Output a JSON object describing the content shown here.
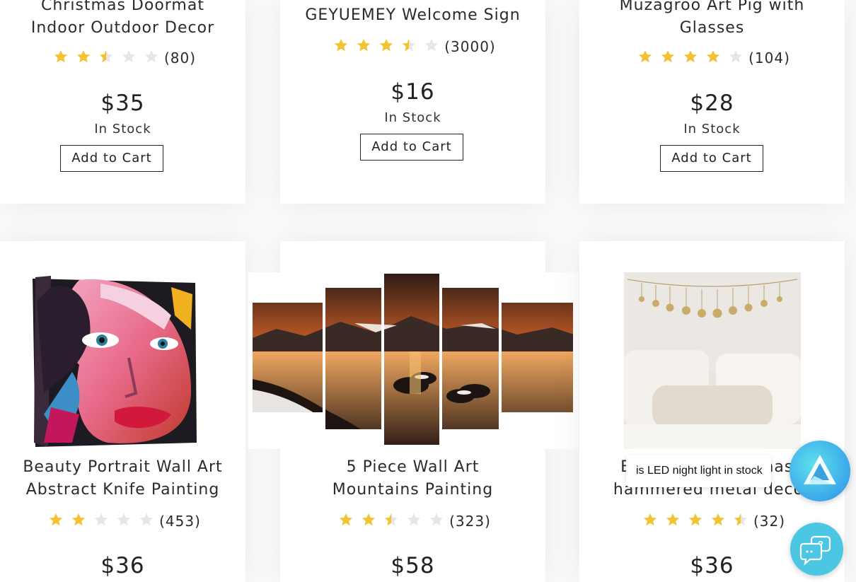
{
  "products": [
    {
      "title_lines": [
        "Christmas Doormat",
        "Indoor Outdoor Decor"
      ],
      "rating": 2.5,
      "review_count": "(80)",
      "price": "$35",
      "stock": "In Stock",
      "cart_label": "Add to Cart"
    },
    {
      "title_lines": [
        "GEYUEMEY Welcome Sign"
      ],
      "rating": 3.5,
      "review_count": "(3000)",
      "price": "$16",
      "stock": "In Stock",
      "cart_label": "Add to Cart"
    },
    {
      "title_lines": [
        "Muzagroo Art Pig with",
        "Glasses"
      ],
      "rating": 4,
      "review_count": "(104)",
      "price": "$28",
      "stock": "In Stock",
      "cart_label": "Add to Cart"
    },
    {
      "title_lines": [
        "Beauty Portrait Wall Art",
        "Abstract Knife Painting"
      ],
      "rating": 2,
      "review_count": "(453)",
      "price": "$36",
      "image_icon": "portrait-painting-image"
    },
    {
      "title_lines": [
        "5 Piece Wall Art",
        "Mountains Painting"
      ],
      "rating": 2.5,
      "review_count": "(323)",
      "price": "$58",
      "image_icon": "mountain-lake-sunset-panels-image"
    },
    {
      "title_lines": [
        "Beautiful Moon phase",
        "hammered metal decor"
      ],
      "rating": 4.5,
      "review_count": "(32)",
      "price": "$36",
      "image_icon": "moon-phase-garland-bedroom-image"
    }
  ],
  "overlay": {
    "tooltip_text": "is LED night light in stock",
    "assistant_icon": "assistant-logo-icon",
    "chat_icon": "chat-help-icon"
  },
  "colors": {
    "star_filled": "#f2c230",
    "star_empty": "#e6e6e6",
    "chat_button": "#4cc7e3"
  }
}
